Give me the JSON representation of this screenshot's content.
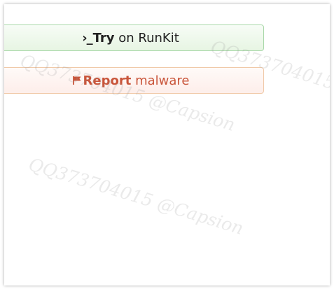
{
  "buttons": {
    "try": {
      "icon": "terminal-prompt-icon",
      "icon_text": "›_",
      "bold": "Try",
      "rest": " on RunKit",
      "color": "#222222"
    },
    "report": {
      "icon": "flag-icon",
      "bold": "Report",
      "rest": " malware",
      "color": "#c9553a"
    }
  },
  "watermark": {
    "text": "QQ373704015 @Capsion"
  }
}
